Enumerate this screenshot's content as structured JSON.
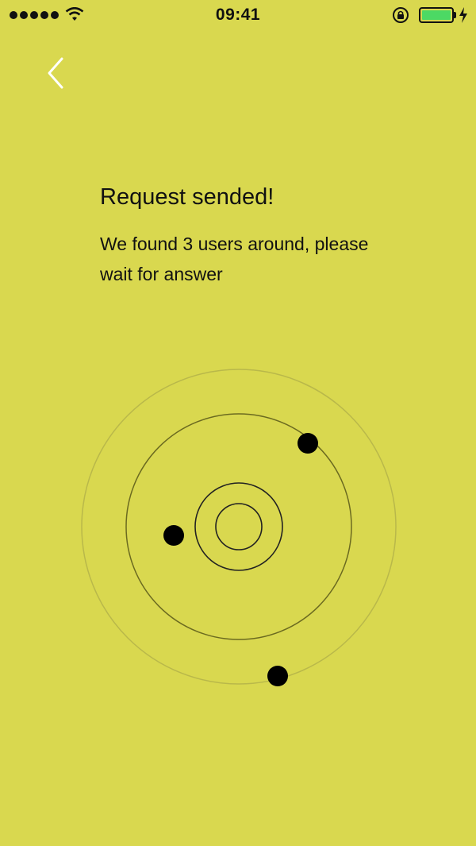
{
  "status_bar": {
    "time": "09:41",
    "signal_icon": "signal-dots-icon",
    "wifi_icon": "wifi-icon",
    "lock_icon": "orientation-lock-icon",
    "battery_icon": "battery-icon",
    "charging_icon": "charging-bolt-icon",
    "battery_color": "#4cd964"
  },
  "nav": {
    "back_icon": "chevron-left-icon"
  },
  "content": {
    "title": "Request sended!",
    "message": "We found 3 users around, please wait for answer"
  },
  "radar": {
    "user_count": 3,
    "background_color": "#d9d84f",
    "ring_color": "#6b6a20",
    "dot_color": "#000000"
  }
}
